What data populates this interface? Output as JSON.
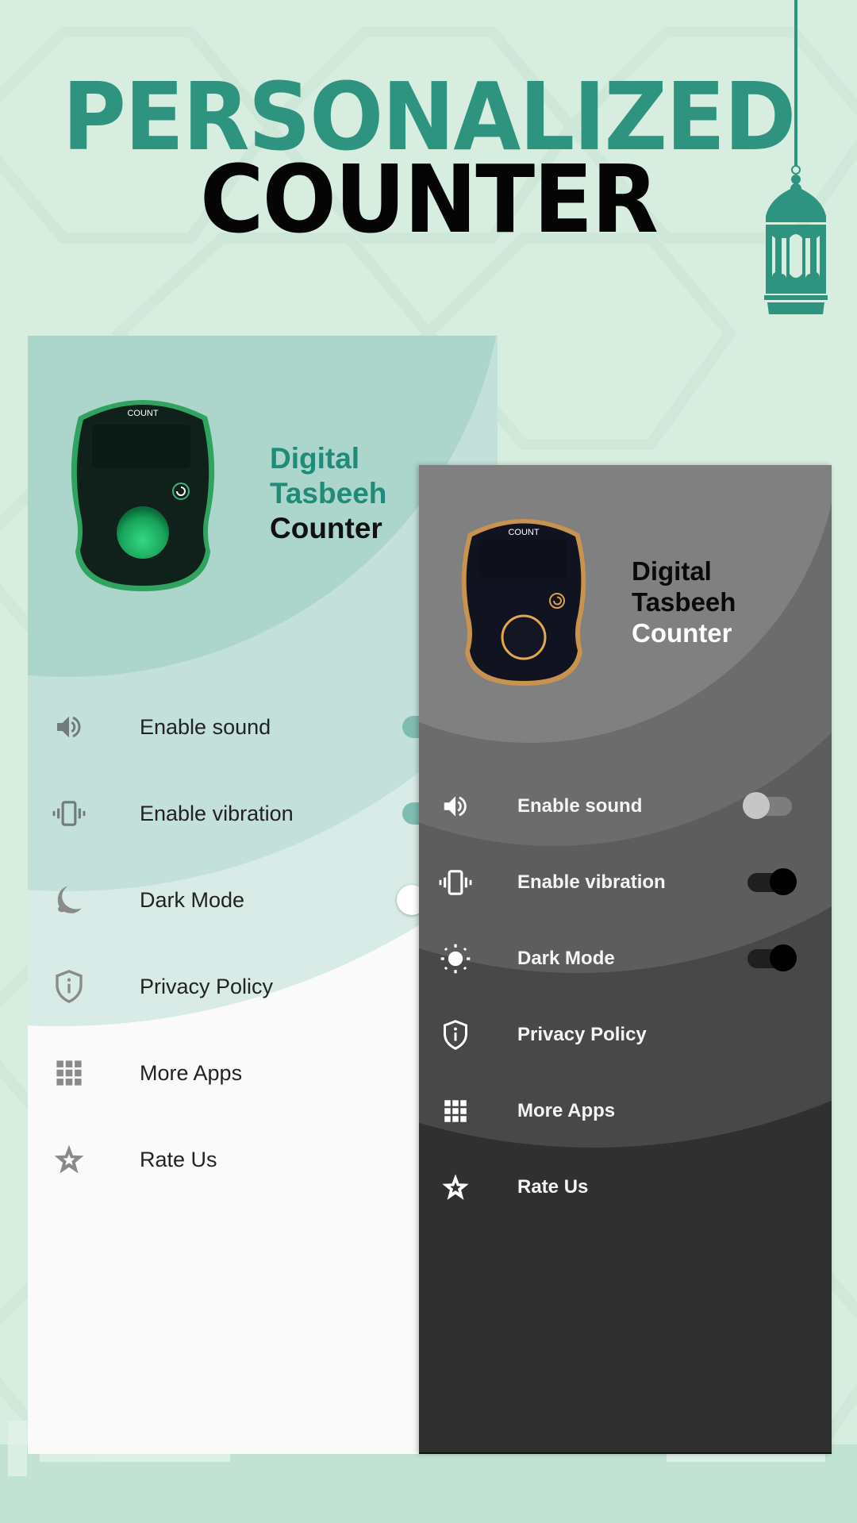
{
  "headline": {
    "line1": "PERSONALIZED",
    "line2": "COUNTER"
  },
  "colors": {
    "accent": "#2e9480",
    "background": "#d7ede0",
    "light_panel": "#fafafa",
    "dark_panel": "#303030",
    "light_device_rim": "#2fa35f",
    "dark_device_rim": "#c8934e"
  },
  "light_screen": {
    "device": {
      "label": "COUNT",
      "reset_icon": "reset-icon",
      "button_icon": "green-count-button"
    },
    "brand": {
      "line1": "Digital",
      "line2": "Tasbeeh",
      "line3": "Counter"
    },
    "menu": [
      {
        "icon": "speaker-icon",
        "label": "Enable sound",
        "toggle": true,
        "on": true
      },
      {
        "icon": "vibration-icon",
        "label": "Enable vibration",
        "toggle": true,
        "on": true
      },
      {
        "icon": "moon-icon",
        "label": "Dark Mode",
        "toggle": true,
        "on": false
      },
      {
        "icon": "shield-info-icon",
        "label": "Privacy Policy",
        "toggle": false
      },
      {
        "icon": "apps-grid-icon",
        "label": "More Apps",
        "toggle": false
      },
      {
        "icon": "star-icon",
        "label": "Rate Us",
        "toggle": false
      }
    ]
  },
  "dark_screen": {
    "device": {
      "label": "COUNT",
      "reset_icon": "reset-icon",
      "button_icon": "gold-count-button"
    },
    "brand": {
      "line1": "Digital",
      "line2": "Tasbeeh",
      "line3": "Counter"
    },
    "menu": [
      {
        "icon": "speaker-icon",
        "label": "Enable sound",
        "toggle": true,
        "on": false
      },
      {
        "icon": "vibration-icon",
        "label": "Enable vibration",
        "toggle": true,
        "on": true
      },
      {
        "icon": "sun-icon",
        "label": "Dark Mode",
        "toggle": true,
        "on": true
      },
      {
        "icon": "shield-info-icon",
        "label": "Privacy Policy",
        "toggle": false
      },
      {
        "icon": "apps-grid-icon",
        "label": "More Apps",
        "toggle": false
      },
      {
        "icon": "star-icon",
        "label": "Rate Us",
        "toggle": false
      }
    ]
  }
}
